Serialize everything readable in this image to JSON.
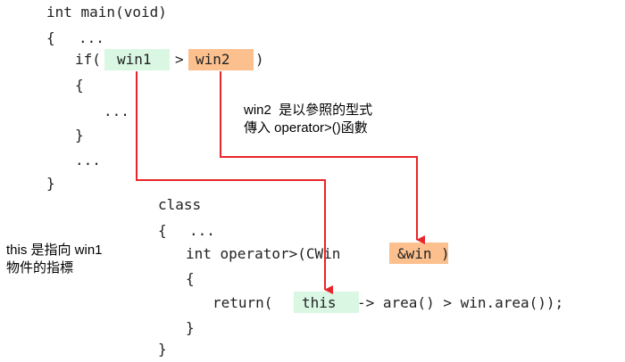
{
  "code_main": {
    "line1": "int main(void)",
    "line2_brace": "{",
    "line2_dots": "...",
    "if_open": "if(",
    "win1": "win1",
    "gt": ">",
    "win2": "win2",
    "if_close": ")",
    "inner_open": "{",
    "inner_dots": "...",
    "inner_close": "}",
    "after_dots": "...",
    "close": "}"
  },
  "code_class": {
    "class_kw": "class",
    "brace_open": "{",
    "dots": "...",
    "op_prefix": "int operator>(CWin",
    "op_ref": "&win",
    "op_suffix": ")",
    "body_open": "{",
    "return_prefix": "return(",
    "this_kw": "this",
    "return_suffix": "-> area() > win.area());",
    "body_close": "}",
    "close": "}"
  },
  "notes": {
    "win2_line1": "win2  是以參照的型式",
    "win2_line2": "傳入 operator>()函數",
    "this_line1": "this 是指向 win1",
    "this_line2": "物件的指標"
  },
  "colors": {
    "arrow": "#e8262a",
    "highlight_green": "#d9f7e2",
    "highlight_orange": "#fbc08e"
  }
}
